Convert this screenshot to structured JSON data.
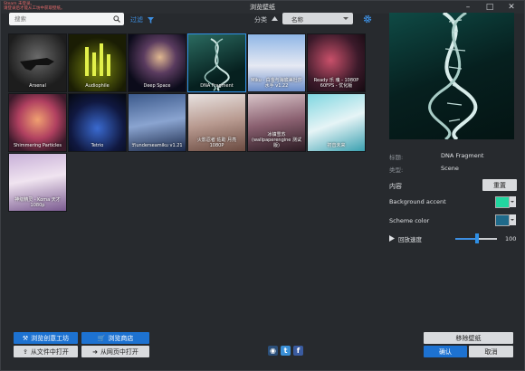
{
  "window": {
    "title": "浏览壁纸",
    "warning_line1": "Steam 未登录。",
    "warning_line2": "请登录后才能从工坊中获取壁纸。"
  },
  "toolbar": {
    "search_placeholder": "搜索",
    "filter_label": "过滤",
    "sort_label": "分类",
    "sort_value": "名称"
  },
  "wallpapers": [
    {
      "title": "Arsenal"
    },
    {
      "title": "Audiophile"
    },
    {
      "title": "Deep Space"
    },
    {
      "title": "DNA Fragment"
    },
    {
      "title": "Miku - 白金与海底美杜莎 水手 v1.22"
    },
    {
      "title": "Ready 乐 魂 - 1080P 60FPS - 优化版"
    },
    {
      "title": "Shimmering Particles"
    },
    {
      "title": "Tetrio"
    },
    {
      "title": "卐underseamiku v1.21"
    },
    {
      "title": "火影忍者 佐助 月亮 1080P"
    },
    {
      "title": "冰镇雪苏 (wallpaperengine 测试版)"
    },
    {
      "title": "初音未来"
    },
    {
      "title": "神级精灵 - Koma 天才 1080p"
    }
  ],
  "details": {
    "title_label": "标题:",
    "title_value": "DNA Fragment",
    "type_label": "类型:",
    "type_value": "Scene",
    "content_label": "内容",
    "reset_label": "重置",
    "bg_accent_label": "Background accent",
    "bg_accent_color": "#22d6a0",
    "scheme_color_label": "Scheme color",
    "scheme_color": "#1f6a8a",
    "playback_label": "回放速度",
    "playback_value": "100",
    "playback_fraction": 0.5
  },
  "footer": {
    "browse_workshop": "浏览创意工坊",
    "browse_store": "浏览商店",
    "open_file": "从文件中打开",
    "open_web": "从网页中打开",
    "remove_wallpaper": "移除壁纸",
    "ok": "确认",
    "cancel": "取消"
  }
}
